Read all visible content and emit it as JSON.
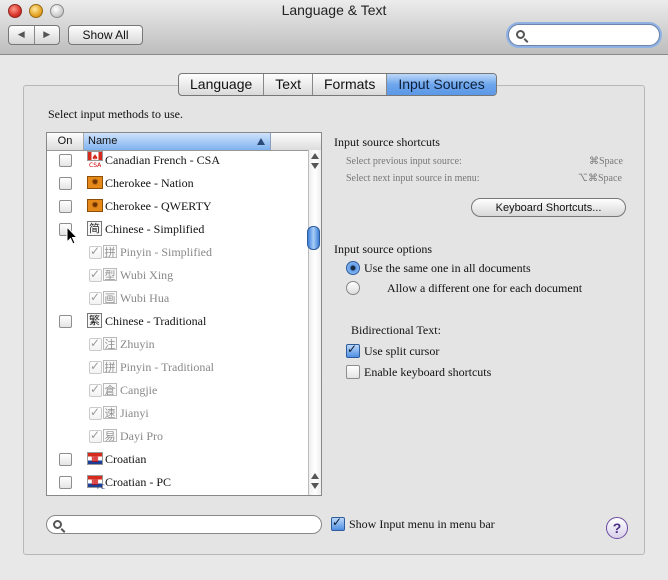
{
  "window": {
    "title": "Language & Text"
  },
  "toolbar": {
    "show_all": "Show All",
    "search_placeholder": ""
  },
  "tabs": [
    "Language",
    "Text",
    "Formats",
    "Input Sources"
  ],
  "instructions": "Select input methods to use.",
  "list": {
    "col_on": "On",
    "col_name": "Name",
    "rows": [
      {
        "label": "Canadian French - CSA",
        "checked": false,
        "dim": false
      },
      {
        "label": "Cherokee - Nation",
        "checked": false,
        "dim": false
      },
      {
        "label": "Cherokee - QWERTY",
        "checked": false,
        "dim": false
      },
      {
        "label": "Chinese - Simplified",
        "checked": false,
        "dim": false,
        "icon": "简"
      },
      {
        "label": "Pinyin - Simplified",
        "checked": true,
        "dim": true,
        "icon": "拼"
      },
      {
        "label": "Wubi Xing",
        "checked": true,
        "dim": true,
        "icon": "型"
      },
      {
        "label": "Wubi Hua",
        "checked": true,
        "dim": true,
        "icon": "画"
      },
      {
        "label": "Chinese - Traditional",
        "checked": false,
        "dim": false,
        "icon": "繁"
      },
      {
        "label": "Zhuyin",
        "checked": true,
        "dim": true,
        "icon": "注"
      },
      {
        "label": "Pinyin - Traditional",
        "checked": true,
        "dim": true,
        "icon": "拼"
      },
      {
        "label": "Cangjie",
        "checked": true,
        "dim": true,
        "icon": "倉"
      },
      {
        "label": "Jianyi",
        "checked": true,
        "dim": true,
        "icon": "速"
      },
      {
        "label": "Dayi Pro",
        "checked": true,
        "dim": true,
        "icon": "易"
      },
      {
        "label": "Croatian",
        "checked": false,
        "dim": false
      },
      {
        "label": "Croatian - PC",
        "checked": false,
        "dim": false
      }
    ],
    "csa_badge": "CSA",
    "pc_badge": "PC"
  },
  "shortcuts": {
    "heading": "Input source shortcuts",
    "prev_label": "Select previous input source:",
    "prev_key": "⌘Space",
    "next_label": "Select next input source in menu:",
    "next_key": "⌥⌘Space",
    "button": "Keyboard Shortcuts..."
  },
  "options": {
    "heading": "Input source options",
    "radio_same": "Use the same one in all documents",
    "radio_diff": "Allow a different one for each document",
    "same_selected": true
  },
  "bidi": {
    "heading": "Bidirectional Text:",
    "split_cursor": "Use split cursor",
    "split_cursor_checked": true,
    "kbd_shortcuts": "Enable keyboard shortcuts",
    "kbd_shortcuts_checked": false
  },
  "footer": {
    "search_placeholder": "",
    "show_menu": "Show Input menu in menu bar",
    "show_menu_checked": true,
    "help": "?"
  }
}
